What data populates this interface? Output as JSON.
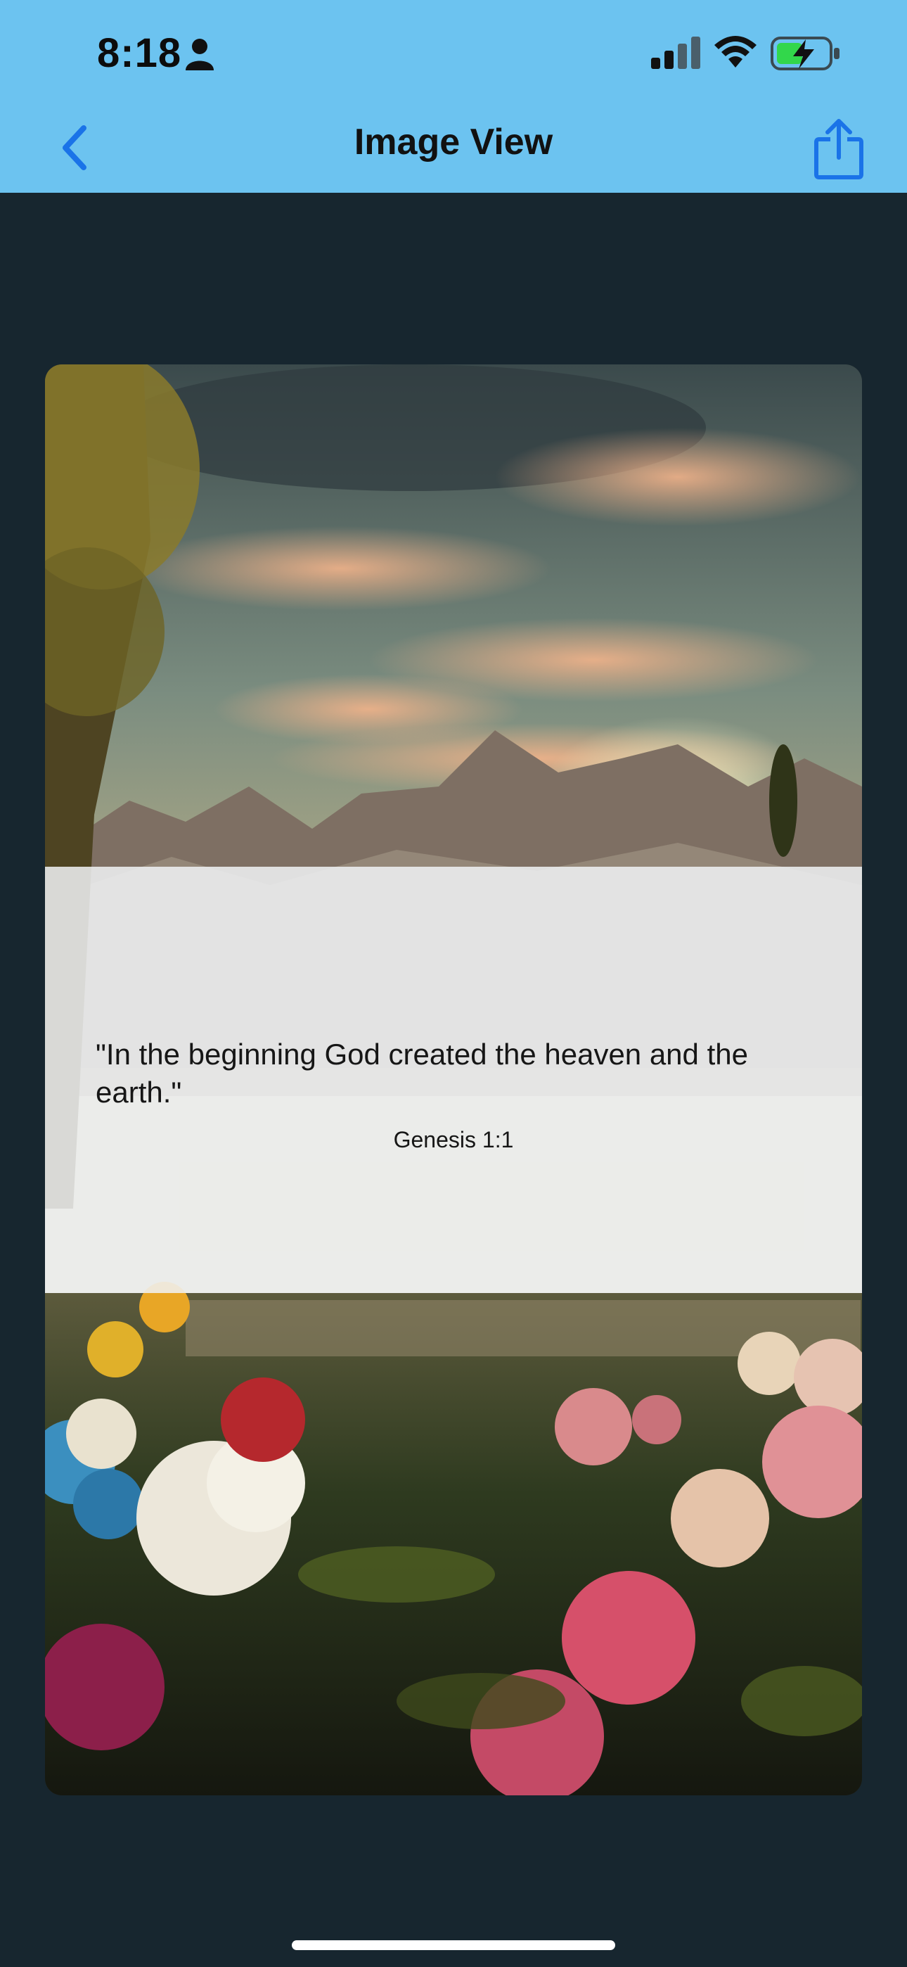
{
  "status_bar": {
    "time": "8:18",
    "icons": [
      "person-icon",
      "signal-icon",
      "wifi-icon",
      "battery-charging-icon"
    ]
  },
  "nav": {
    "title": "Image View",
    "back_icon": "chevron-left-icon",
    "share_icon": "share-icon"
  },
  "card": {
    "quote": "\"In the beginning God created the heaven and the earth.\"",
    "reference": "Genesis 1:1"
  },
  "colors": {
    "nav_background": "#6cc3f0",
    "page_background": "#17262f",
    "accent": "#1a73e8"
  }
}
